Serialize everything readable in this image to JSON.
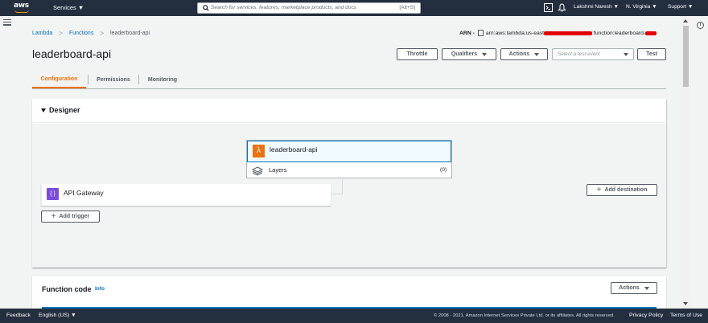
{
  "topnav": {
    "logo_text": "aws",
    "services_label": "Services ▼",
    "search_placeholder": "Search for services, features, marketplace products, and docs",
    "search_shortcut": "[Alt+S]",
    "user": "Lakshmi Naresh ▼",
    "region": "N. Virginia ▼",
    "support": "Support ▼"
  },
  "breadcrumb": {
    "items": [
      "Lambda",
      "Functions",
      "leaderboard-api"
    ]
  },
  "arn": {
    "label": "ARN -",
    "prefix": "arn:aws:lambda:us-east",
    "suffix": ":function:leaderboard-"
  },
  "page": {
    "title": "leaderboard-api"
  },
  "header_actions": {
    "throttle": "Throttle",
    "qualifiers": "Qualifiers",
    "actions": "Actions",
    "test_event_placeholder": "Select a test event",
    "test": "Test"
  },
  "tabs": [
    {
      "label": "Configuration",
      "active": true
    },
    {
      "label": "Permissions",
      "active": false
    },
    {
      "label": "Monitoring",
      "active": false
    }
  ],
  "designer": {
    "title": "Designer",
    "function_name": "leaderboard-api",
    "layers_label": "Layers",
    "layers_count": "(0)",
    "trigger_name": "API Gateway",
    "add_trigger": "Add trigger",
    "add_destination": "Add destination"
  },
  "function_code": {
    "title": "Function code",
    "info": "Info",
    "actions": "Actions"
  },
  "footer": {
    "feedback": "Feedback",
    "language": "English (US) ▼",
    "copyright": "© 2008 - 2021, Amazon Internet Services Private Ltd. or its affiliates. All rights reserved.",
    "privacy": "Privacy Policy",
    "terms": "Terms of Use"
  },
  "colors": {
    "nav_bg": "#232f3e",
    "accent_orange": "#ec7211",
    "link_blue": "#0073bb",
    "api_gateway_purple": "#7b4ddb",
    "redaction_red": "#e00000"
  }
}
